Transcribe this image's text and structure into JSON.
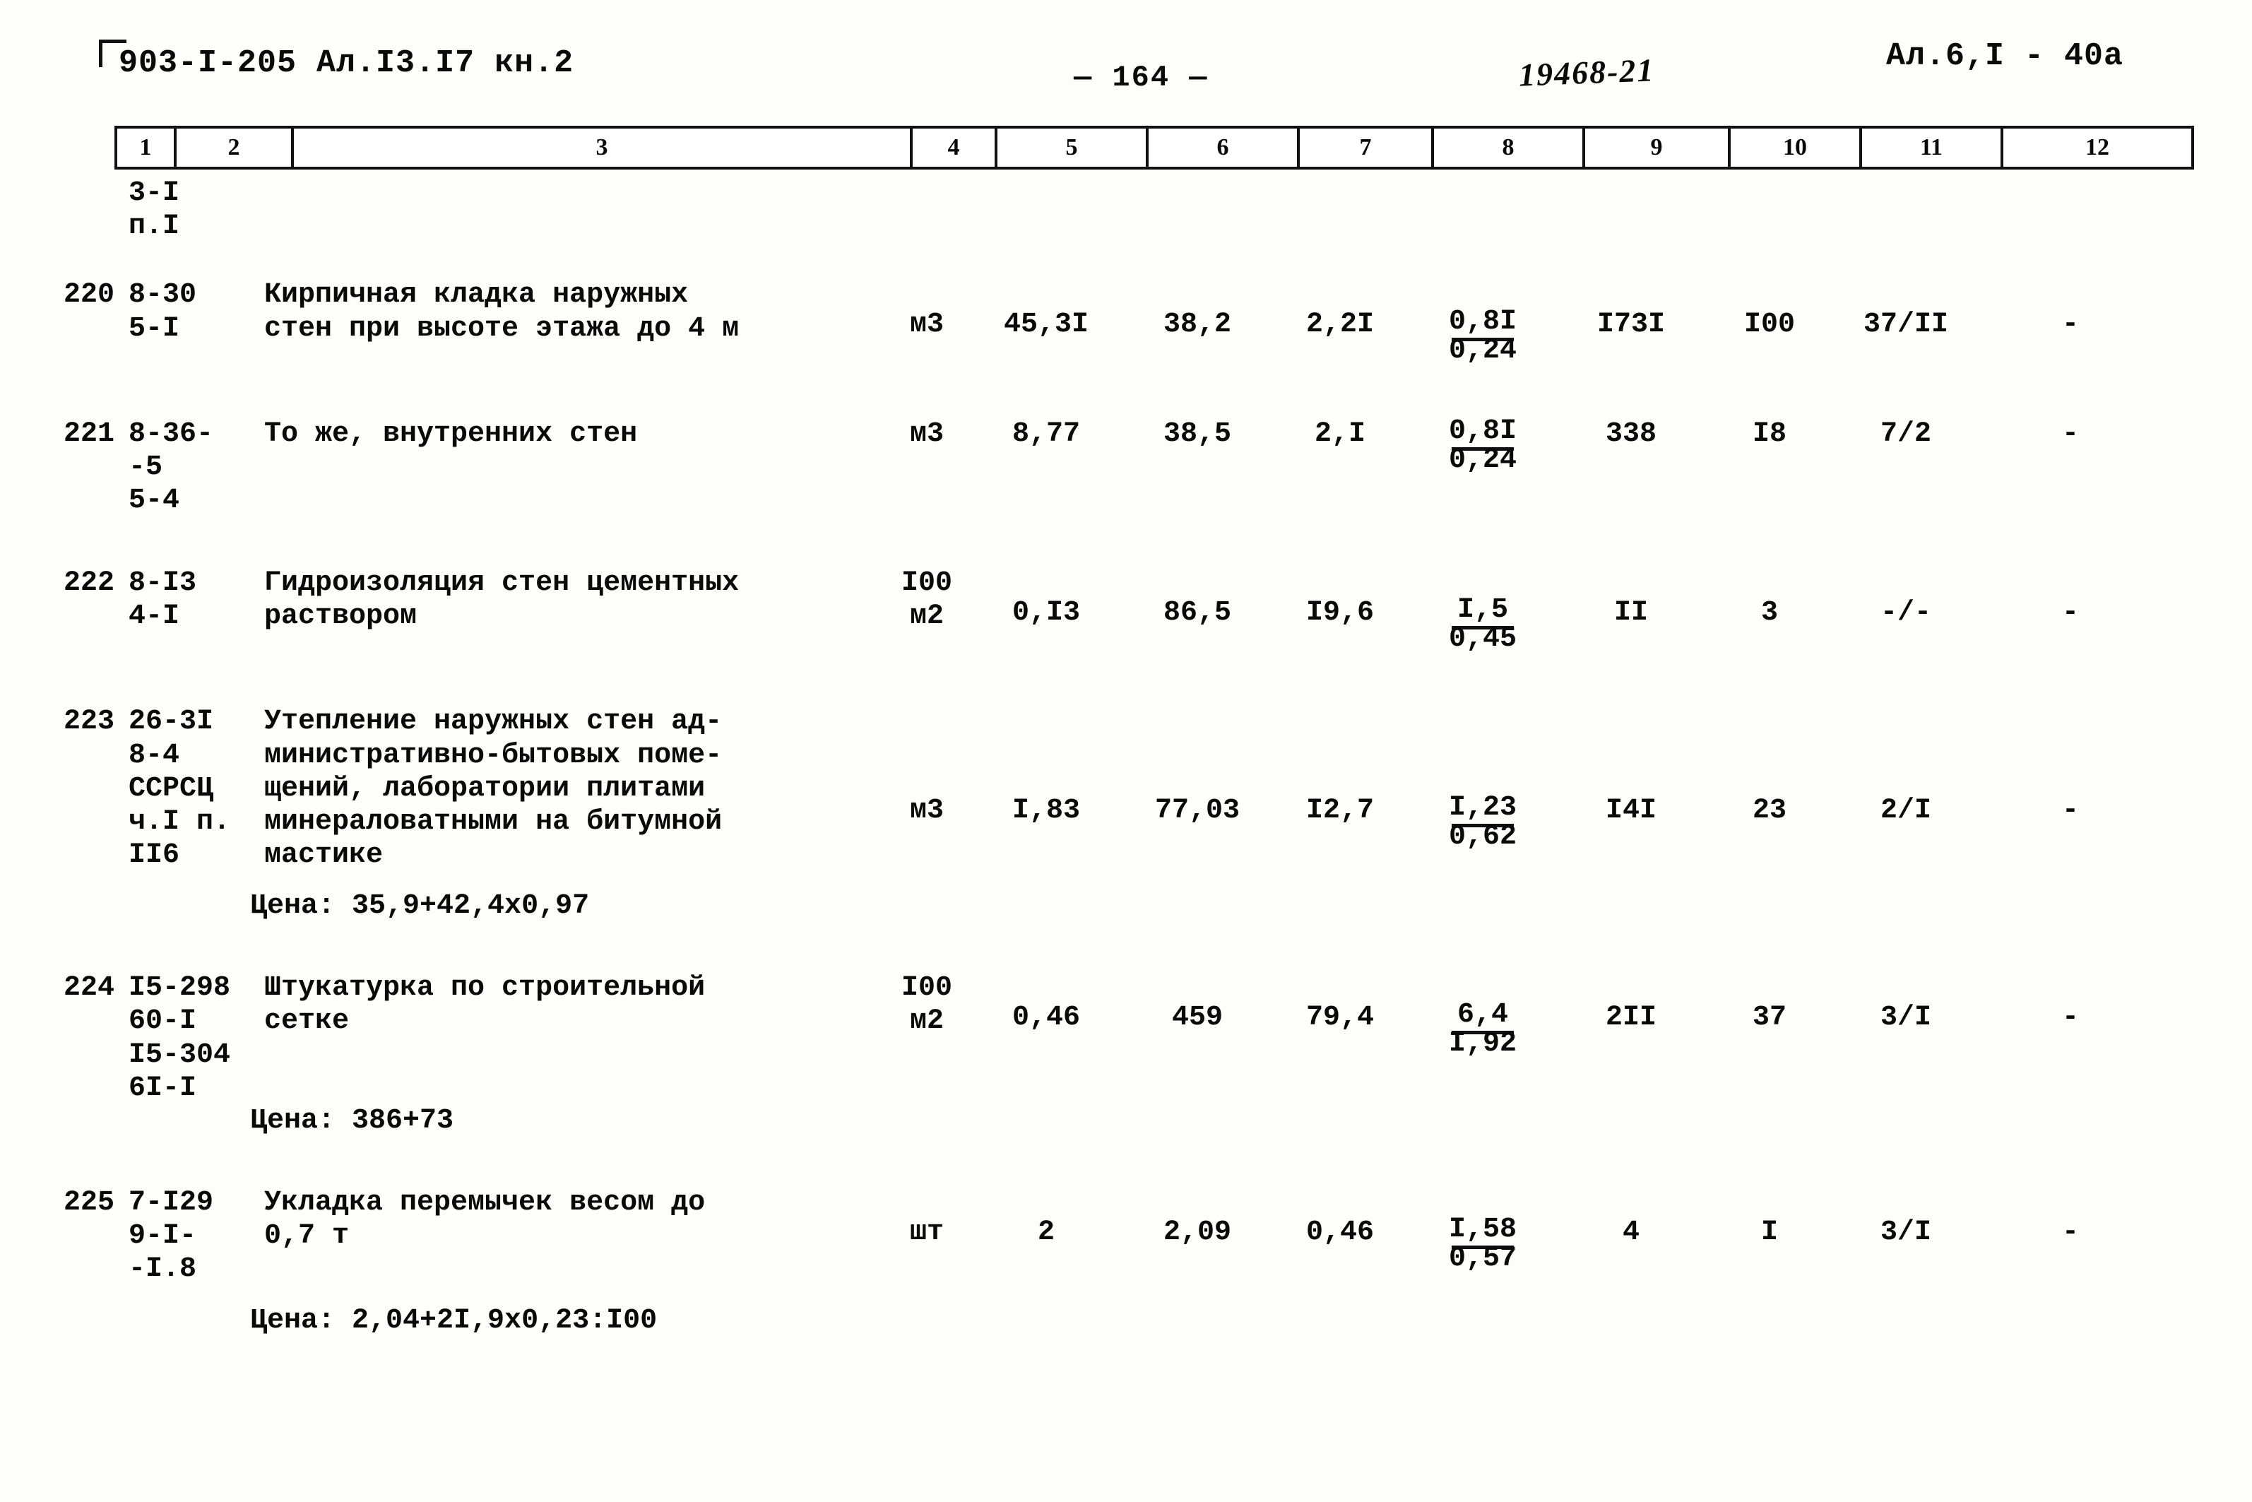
{
  "header": {
    "left_code": "903-I-205 Ал.I3.I7 кн.2",
    "page_number": "— 164 —",
    "stamp": "19468-21",
    "right_code": "Ал.6,I - 40а"
  },
  "table": {
    "column_numbers": [
      "1",
      "2",
      "3",
      "4",
      "5",
      "6",
      "7",
      "8",
      "9",
      "10",
      "11",
      "12"
    ],
    "prefix_row": {
      "code": "3-I\nп.I"
    },
    "rows": [
      {
        "num": "220",
        "code": "8-30\n5-I",
        "desc": "Кирпичная кладка наружных\nстен при высоте этажа до 4 м",
        "unit": "м3",
        "c5": "45,3I",
        "c6": "38,2",
        "c7": "2,2I",
        "c8_top": "0,8I",
        "c8_bottom": "0,24",
        "c9": "I73I",
        "c10": "I00",
        "c11": "37/II",
        "c12": "-"
      },
      {
        "num": "221",
        "code": "8-36-\n-5\n5-4",
        "desc": "То же, внутренних стен",
        "unit": "м3",
        "c5": "8,77",
        "c6": "38,5",
        "c7": "2,I",
        "c8_top": "0,8I",
        "c8_bottom": "0,24",
        "c9": "338",
        "c10": "I8",
        "c11": "7/2",
        "c12": "-"
      },
      {
        "num": "222",
        "code": "8-I3\n4-I",
        "desc": "Гидроизоляция стен цементных\nраствором",
        "unit": "I00\nм2",
        "c5": "0,I3",
        "c6": "86,5",
        "c7": "I9,6",
        "c8_top": "I,5",
        "c8_bottom": "0,45",
        "c9": "II",
        "c10": "3",
        "c11": "-/-",
        "c12": "-"
      },
      {
        "num": "223",
        "code": "26-3I\n8-4\nССРСЦ\nч.I п.\nII6",
        "desc": "Утепление наружных стен ад-\nминистративно-бытовых поме-\nщений, лаборатории плитами\nминераловатными на битумной\nмастике",
        "unit": "м3",
        "c5": "I,83",
        "c6": "77,03",
        "c7": "I2,7",
        "c8_top": "I,23",
        "c8_bottom": "0,62",
        "c9": "I4I",
        "c10": "23",
        "c11": "2/I",
        "c12": "-",
        "price": "Цена: 35,9+42,4х0,97"
      },
      {
        "num": "224",
        "code": "I5-298\n60-I\nI5-304\n6I-I",
        "desc": "Штукатурка по строительной\nсетке",
        "unit": "I00\nм2",
        "c5": "0,46",
        "c6": "459",
        "c7": "79,4",
        "c8_top": "6,4",
        "c8_bottom": "I,92",
        "c9": "2II",
        "c10": "37",
        "c11": "3/I",
        "c12": "-",
        "price": "Цена: 386+73"
      },
      {
        "num": "225",
        "code": "7-I29\n9-I-\n-I.8",
        "desc": "Укладка перемычек весом до\n0,7  т",
        "unit": "шт",
        "c5": "2",
        "c6": "2,09",
        "c7": "0,46",
        "c8_top": "I,58",
        "c8_bottom": "0,57",
        "c9": "4",
        "c10": "I",
        "c11": "3/I",
        "c12": "-",
        "price": "Цена: 2,04+2I,9х0,23:I00"
      }
    ]
  }
}
